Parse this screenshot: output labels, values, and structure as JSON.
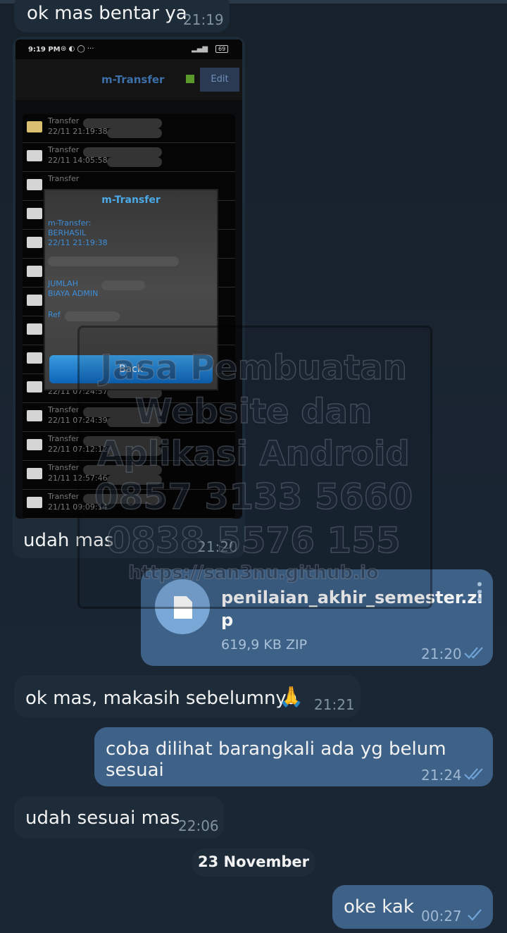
{
  "messages": {
    "m1": {
      "text": "ok mas bentar ya",
      "time": "21:19"
    },
    "m2": {
      "text": "udah mas",
      "time": "21:20"
    },
    "file": {
      "name_line1": "penilaian_akhir_semester.zi",
      "name_line2": "p",
      "meta": "619,9 KB ZIP",
      "time": "21:20",
      "icon": "file-icon"
    },
    "m3": {
      "text": "ok mas, makasih sebelumnya",
      "emoji": "🙏",
      "time": "21:21"
    },
    "m4": {
      "text": "coba dilihat barangkali ada yg belum sesuai",
      "time": "21:24"
    },
    "m5": {
      "text": "udah sesuai mas",
      "time": "22:06"
    },
    "date_divider": "23 November",
    "m6": {
      "text": "oke kak",
      "time": "00:27"
    }
  },
  "screenshot": {
    "status_time": "9:19 PM",
    "status_icons": "⊛ ◐ ◯ ···",
    "battery": "69",
    "app_title": "m-Transfer",
    "edit_label": "Edit",
    "rows": [
      {
        "label": "Transfer",
        "date": "22/11 21:19:38"
      },
      {
        "label": "Transfer",
        "date": "22/11 14:05:58"
      },
      {
        "label": "Transfer",
        "date": ""
      },
      {
        "label": "",
        "date": ""
      },
      {
        "label": "",
        "date": ""
      },
      {
        "label": "",
        "date": ""
      },
      {
        "label": "",
        "date": ""
      },
      {
        "label": "",
        "date": ""
      },
      {
        "label": "",
        "date": ""
      },
      {
        "label": "",
        "date": "22/11 07:24:57"
      },
      {
        "label": "Transfer",
        "date": "22/11 07:24:39"
      },
      {
        "label": "Transfer",
        "date": "22/11 07:12:12"
      },
      {
        "label": "Transfer",
        "date": "21/11 12:57:46"
      },
      {
        "label": "Transfer",
        "date": "21/11 09:09:14"
      }
    ],
    "dialog": {
      "title": "m-Transfer",
      "line1": "m-Transfer:",
      "line2": "BERHASIL",
      "line3": "22/11 21:19:38",
      "line4": "JUMLAH",
      "line5": "BIAYA ADMIN",
      "line6": "Ref",
      "back": "Back"
    }
  },
  "watermark": {
    "line1": "Jasa Pembuatan",
    "line2": "Website dan",
    "line3": "Aplikasi Android",
    "line4": "0857 3133 5660",
    "line5": "0838 5576 155",
    "line6": "https://san3nu.github.io"
  },
  "colors": {
    "bg": "#17212b",
    "incoming": "#1e2c3a",
    "outgoing": "#3e6187",
    "check": "#6fa3d8"
  }
}
